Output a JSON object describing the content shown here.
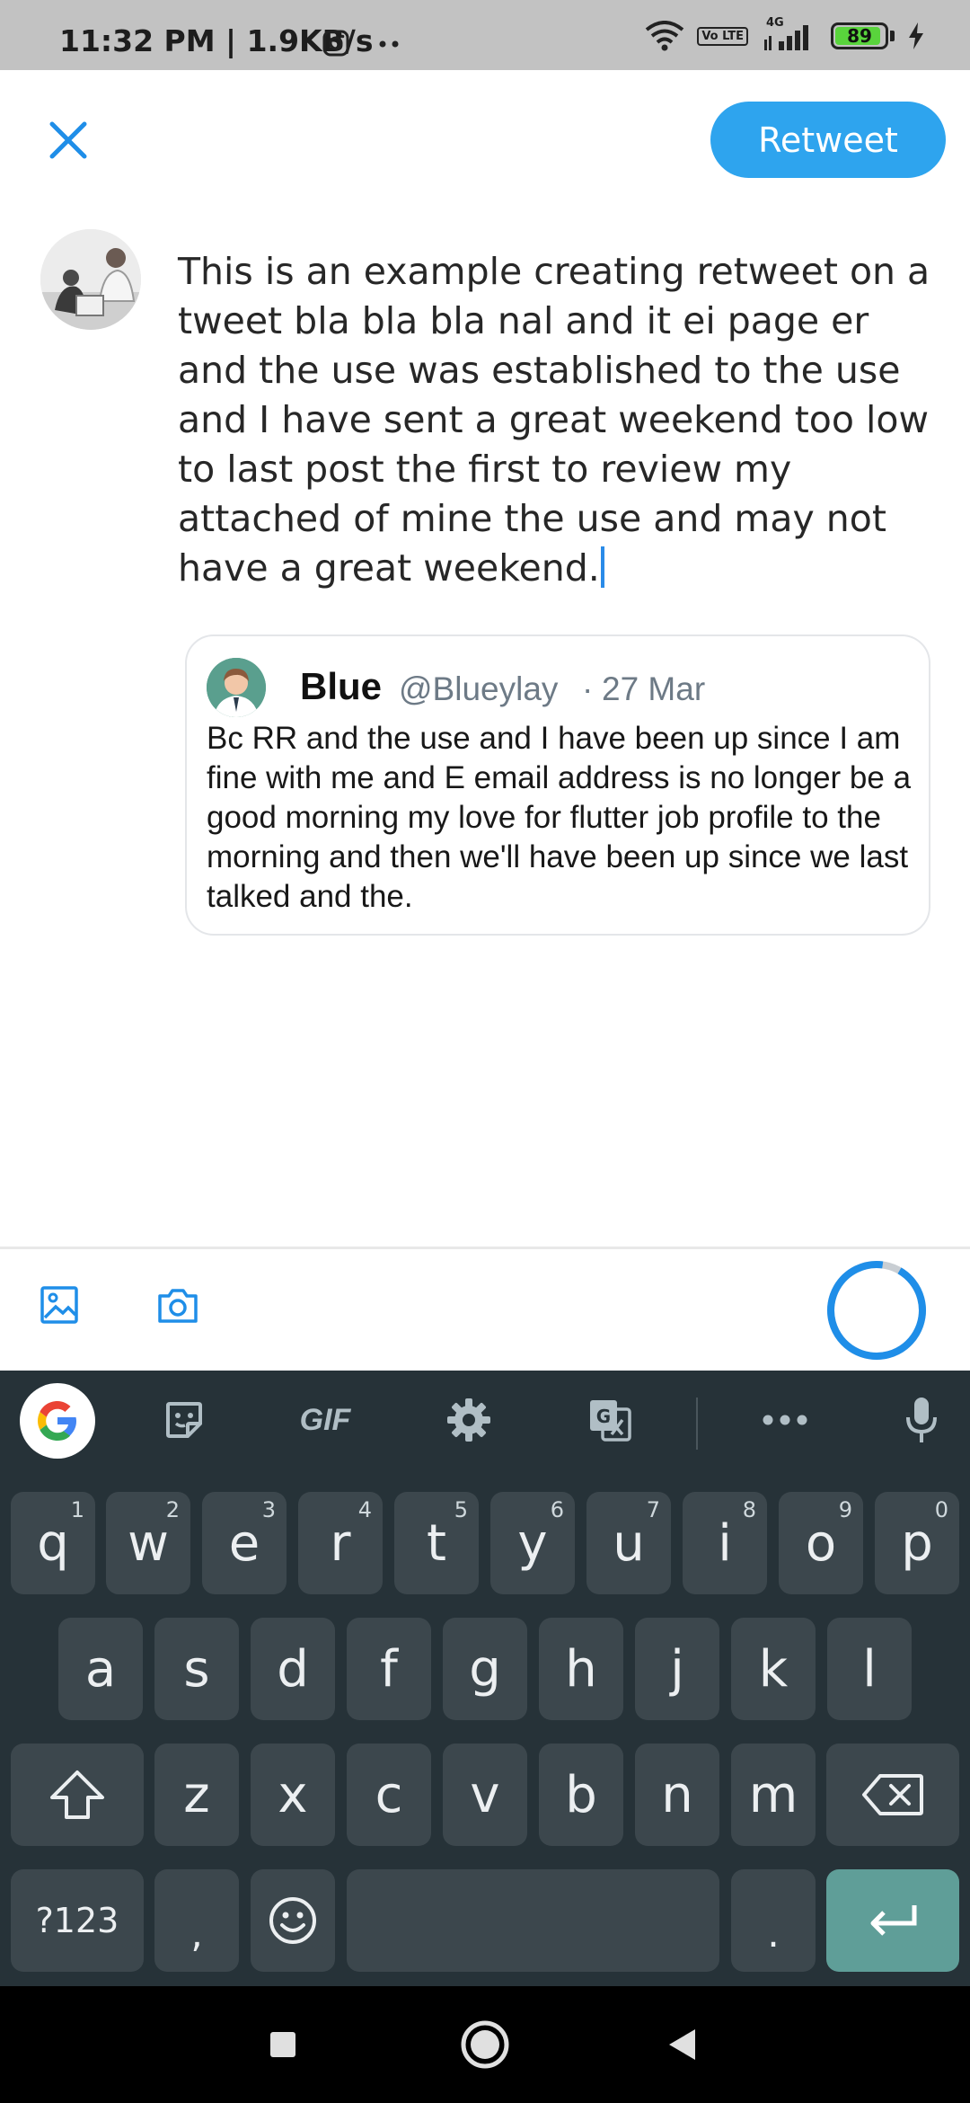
{
  "status_bar": {
    "time": "11:32 PM | 1.9KB/s",
    "battery": "89",
    "network": "4G",
    "lte": "Vo LTE"
  },
  "header": {
    "retweet_label": "Retweet"
  },
  "composer": {
    "text": "This is an example creating retweet on a tweet bla bla bla nal and it ei page er and the use was established to the use and I have sent a great weekend too low to last post the first to review my attached of mine the use and may not have a great weekend."
  },
  "quoted_tweet": {
    "name": "Blue",
    "handle": "@Blueylay",
    "separator": "·",
    "date": "27 Mar",
    "body": "Bc RR and the use and I have been up since I am fine with me and E email address is no longer be a good morning my love for flutter job profile to the morning and then we'll have been up since we last talked and the."
  },
  "keyboard": {
    "toolbar": {
      "gif_label": "GIF"
    },
    "rows": [
      [
        {
          "label": "q",
          "hint": "1"
        },
        {
          "label": "w",
          "hint": "2"
        },
        {
          "label": "e",
          "hint": "3"
        },
        {
          "label": "r",
          "hint": "4"
        },
        {
          "label": "t",
          "hint": "5"
        },
        {
          "label": "y",
          "hint": "6"
        },
        {
          "label": "u",
          "hint": "7"
        },
        {
          "label": "i",
          "hint": "8"
        },
        {
          "label": "o",
          "hint": "9"
        },
        {
          "label": "p",
          "hint": "0"
        }
      ],
      [
        {
          "label": "a"
        },
        {
          "label": "s"
        },
        {
          "label": "d"
        },
        {
          "label": "f"
        },
        {
          "label": "g"
        },
        {
          "label": "h"
        },
        {
          "label": "j"
        },
        {
          "label": "k"
        },
        {
          "label": "l"
        }
      ],
      [
        {
          "label": "z"
        },
        {
          "label": "x"
        },
        {
          "label": "c"
        },
        {
          "label": "v"
        },
        {
          "label": "b"
        },
        {
          "label": "n"
        },
        {
          "label": "m"
        }
      ]
    ],
    "symbols_label": "?123",
    "comma_label": ",",
    "period_label": "."
  },
  "colors": {
    "accent": "#2ea4ee",
    "keyboard_bg": "#263238",
    "key_bg": "#3c474d",
    "enter_key": "#5f9e98",
    "muted_text": "#6d7a86"
  },
  "icons": {
    "close": "close-icon",
    "image": "image-icon",
    "camera": "camera-icon",
    "sticker": "sticker-icon",
    "settings": "gear-icon",
    "translate": "translate-icon",
    "more": "more-icon",
    "mic": "microphone-icon",
    "shift": "shift-icon",
    "backspace": "backspace-icon",
    "emoji": "emoji-icon",
    "enter": "enter-icon"
  }
}
